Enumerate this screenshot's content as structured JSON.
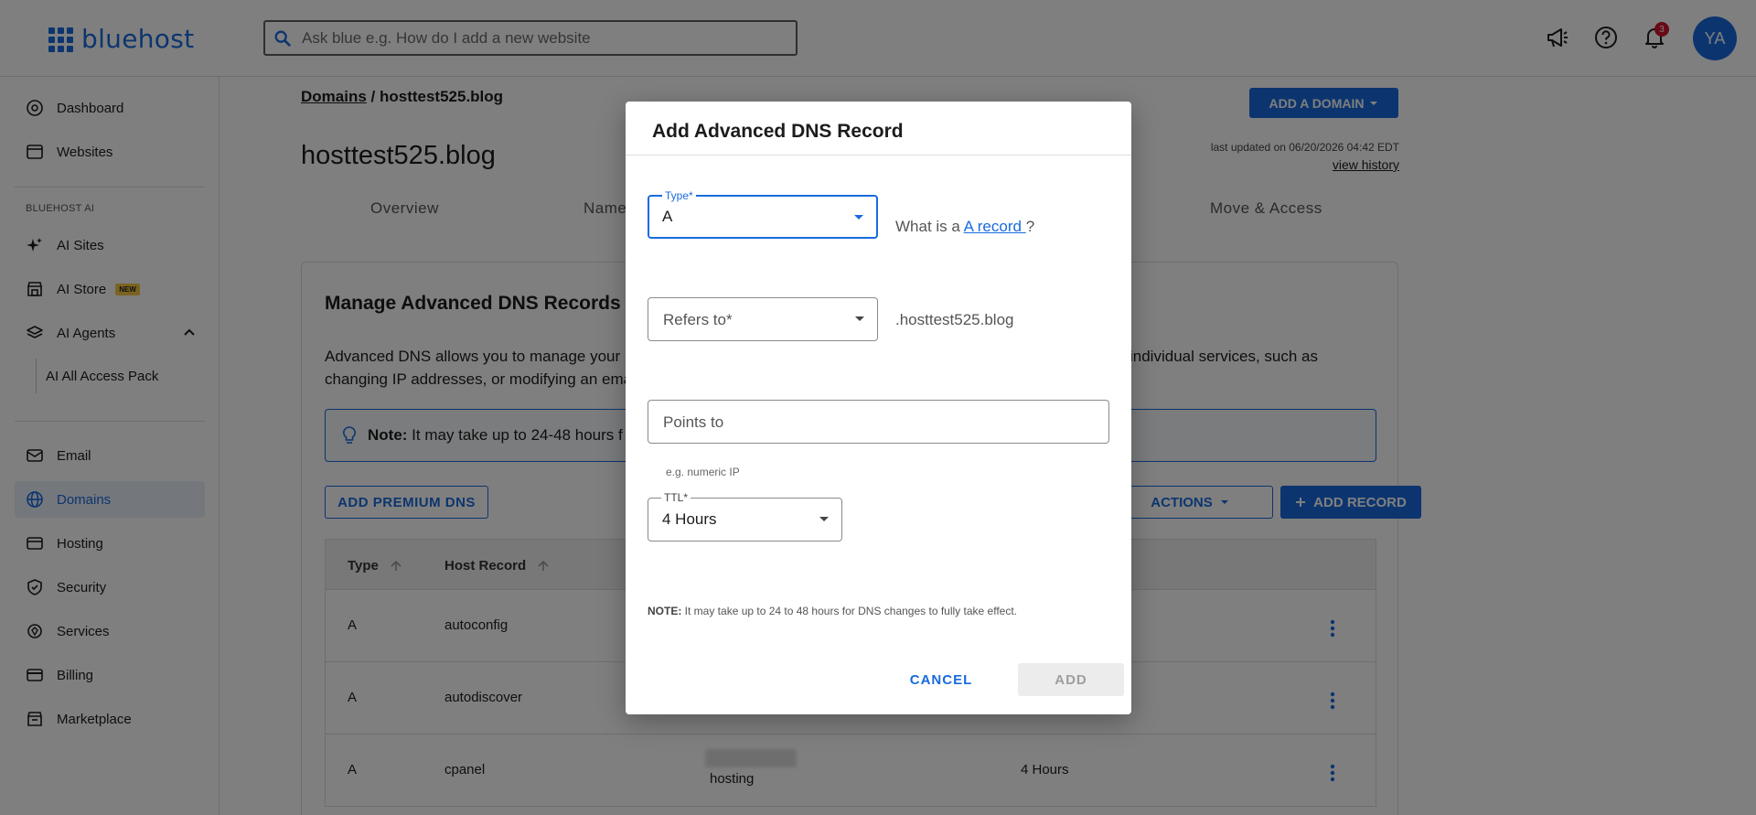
{
  "header": {
    "logo_text": "bluehost",
    "search_placeholder": "Ask blue e.g. How do I add a new website",
    "notification_count": "3",
    "avatar_initials": "YA"
  },
  "sidebar": {
    "items": [
      {
        "label": "Dashboard",
        "icon": "dashboard-icon"
      },
      {
        "label": "Websites",
        "icon": "websites-icon"
      }
    ],
    "ai_section_label": "BLUEHOST AI",
    "ai_items": [
      {
        "label": "AI Sites",
        "icon": "sparkle-icon"
      },
      {
        "label": "AI Store",
        "icon": "store-icon",
        "badge": "NEW"
      },
      {
        "label": "AI Agents",
        "icon": "layers-icon"
      },
      {
        "label": "AI All Access Pack"
      }
    ],
    "bottom_items": [
      {
        "label": "Email",
        "icon": "mail-icon"
      },
      {
        "label": "Domains",
        "icon": "globe-icon",
        "active": true
      },
      {
        "label": "Hosting",
        "icon": "hosting-icon"
      },
      {
        "label": "Security",
        "icon": "shield-icon"
      },
      {
        "label": "Services",
        "icon": "services-icon"
      },
      {
        "label": "Billing",
        "icon": "card-icon"
      },
      {
        "label": "Marketplace",
        "icon": "marketplace-icon"
      }
    ]
  },
  "main": {
    "breadcrumb_root": "Domains",
    "breadcrumb_sep": " / ",
    "breadcrumb_current": "hosttest525.blog",
    "add_domain_label": "ADD A DOMAIN",
    "page_title": "hosttest525.blog",
    "last_updated": "last updated on 06/20/2026 04:42 EDT",
    "view_history": "view history",
    "tabs": [
      "Overview",
      "Name",
      "Move & Access"
    ],
    "card": {
      "title": "Manage Advanced DNS Records",
      "desc_left": "Advanced DNS allows you to manage your D",
      "desc_right": "individual services, such as",
      "desc_line2": "changing IP addresses, or modifying an ema",
      "note_bold": "Note:",
      "note_text": " It may take up to 24-48 hours f",
      "premium_btn": "ADD PREMIUM DNS",
      "actions_btn": "ACTIONS",
      "add_record_btn": "ADD RECORD",
      "columns": [
        "Type",
        "Host Record"
      ],
      "rows": [
        {
          "type": "A",
          "host": "autoconfig",
          "points": "",
          "ttl": ""
        },
        {
          "type": "A",
          "host": "autodiscover",
          "points": "",
          "ttl": ""
        },
        {
          "type": "A",
          "host": "cpanel",
          "points": "hosting",
          "ttl": "4 Hours"
        }
      ]
    }
  },
  "modal": {
    "title": "Add Advanced DNS Record",
    "type_label": "Type*",
    "type_value": "A",
    "help_prefix": "What is a ",
    "help_link": "A record ",
    "help_suffix": "?",
    "refers_placeholder": "Refers to*",
    "refers_suffix": ".hosttest525.blog",
    "points_placeholder": "Points to",
    "points_hint": "e.g. numeric IP",
    "ttl_label": "TTL*",
    "ttl_value": "4 Hours",
    "note_bold": "NOTE:",
    "note_text": " It may take up to 24 to 48 hours for DNS changes to fully take effect.",
    "cancel_label": "CANCEL",
    "add_label": "ADD"
  },
  "colors": {
    "brand_blue": "#196bde",
    "overlay": "rgba(0,0,0,0.5)"
  }
}
